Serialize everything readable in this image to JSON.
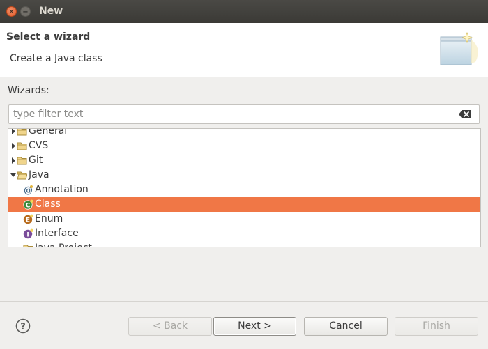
{
  "window": {
    "title": "New"
  },
  "header": {
    "title": "Select a wizard",
    "description": "Create a Java class"
  },
  "wizards_label": "Wizards:",
  "filter": {
    "value": "",
    "placeholder": "type filter text"
  },
  "tree": {
    "items": [
      {
        "label": "General",
        "icon": "folder-icon",
        "expandable": true,
        "expanded": false
      },
      {
        "label": "CVS",
        "icon": "folder-icon",
        "expandable": true,
        "expanded": false
      },
      {
        "label": "Git",
        "icon": "folder-icon",
        "expandable": true,
        "expanded": false
      },
      {
        "label": "Java",
        "icon": "folder-open-icon",
        "expandable": true,
        "expanded": true
      },
      {
        "label": "Annotation",
        "icon": "annotation-icon",
        "selected": false
      },
      {
        "label": "Class",
        "icon": "class-icon",
        "selected": true
      },
      {
        "label": "Enum",
        "icon": "enum-icon",
        "selected": false
      },
      {
        "label": "Interface",
        "icon": "interface-icon",
        "selected": false
      },
      {
        "label": "Java Project",
        "icon": "java-project-icon",
        "selected": false
      }
    ]
  },
  "buttons": {
    "back": "< Back",
    "next": "Next >",
    "cancel": "Cancel",
    "finish": "Finish"
  },
  "colors": {
    "selection": "#f07746",
    "titlebar": "#3c3b37"
  }
}
